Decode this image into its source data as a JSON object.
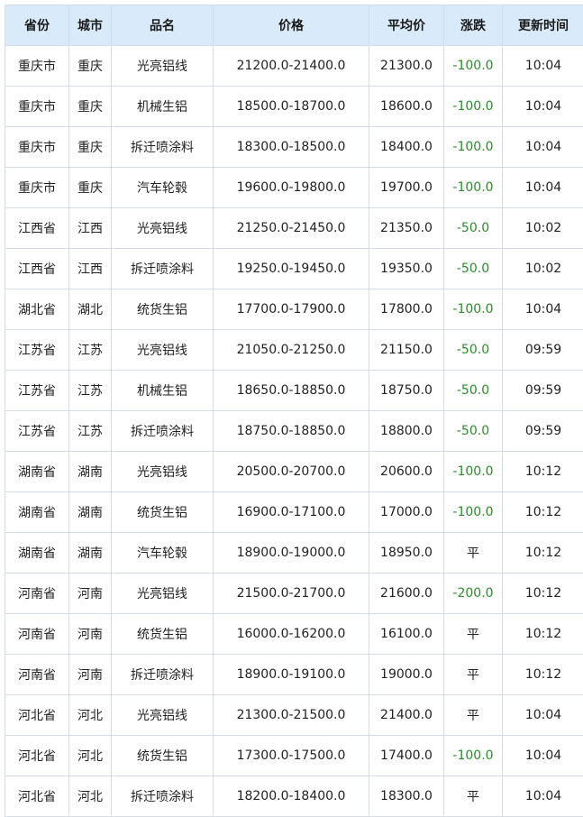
{
  "table": {
    "headers": [
      "省份",
      "城市",
      "品名",
      "价格",
      "平均价",
      "涨跌",
      "更新时间"
    ],
    "rows": [
      [
        "重庆市",
        "重庆",
        "光亮铝线",
        "21200.0-21400.0",
        "21300.0",
        "-100.0",
        "10:04"
      ],
      [
        "重庆市",
        "重庆",
        "机械生铝",
        "18500.0-18700.0",
        "18600.0",
        "-100.0",
        "10:04"
      ],
      [
        "重庆市",
        "重庆",
        "拆迁喷涂料",
        "18300.0-18500.0",
        "18400.0",
        "-100.0",
        "10:04"
      ],
      [
        "重庆市",
        "重庆",
        "汽车轮毂",
        "19600.0-19800.0",
        "19700.0",
        "-100.0",
        "10:04"
      ],
      [
        "江西省",
        "江西",
        "光亮铝线",
        "21250.0-21450.0",
        "21350.0",
        "-50.0",
        "10:02"
      ],
      [
        "江西省",
        "江西",
        "拆迁喷涂料",
        "19250.0-19450.0",
        "19350.0",
        "-50.0",
        "10:02"
      ],
      [
        "湖北省",
        "湖北",
        "统货生铝",
        "17700.0-17900.0",
        "17800.0",
        "-100.0",
        "10:04"
      ],
      [
        "江苏省",
        "江苏",
        "光亮铝线",
        "21050.0-21250.0",
        "21150.0",
        "-50.0",
        "09:59"
      ],
      [
        "江苏省",
        "江苏",
        "机械生铝",
        "18650.0-18850.0",
        "18750.0",
        "-50.0",
        "09:59"
      ],
      [
        "江苏省",
        "江苏",
        "拆迁喷涂料",
        "18750.0-18850.0",
        "18800.0",
        "-50.0",
        "09:59"
      ],
      [
        "湖南省",
        "湖南",
        "光亮铝线",
        "20500.0-20700.0",
        "20600.0",
        "-100.0",
        "10:12"
      ],
      [
        "湖南省",
        "湖南",
        "统货生铝",
        "16900.0-17100.0",
        "17000.0",
        "-100.0",
        "10:12"
      ],
      [
        "湖南省",
        "湖南",
        "汽车轮毂",
        "18900.0-19000.0",
        "18950.0",
        "平",
        "10:12"
      ],
      [
        "河南省",
        "河南",
        "光亮铝线",
        "21500.0-21700.0",
        "21600.0",
        "-200.0",
        "10:12"
      ],
      [
        "河南省",
        "河南",
        "统货生铝",
        "16000.0-16200.0",
        "16100.0",
        "平",
        "10:12"
      ],
      [
        "河南省",
        "河南",
        "拆迁喷涂料",
        "18900.0-19100.0",
        "19000.0",
        "平",
        "10:12"
      ],
      [
        "河北省",
        "河北",
        "光亮铝线",
        "21300.0-21500.0",
        "21400.0",
        "平",
        "10:04"
      ],
      [
        "河北省",
        "河北",
        "统货生铝",
        "17300.0-17500.0",
        "17400.0",
        "-100.0",
        "10:04"
      ],
      [
        "河北省",
        "河北",
        "拆迁喷涂料",
        "18200.0-18400.0",
        "18300.0",
        "平",
        "10:04"
      ]
    ]
  },
  "colors": {
    "header_bg": "#d9ebfb",
    "border": "#d6dde8",
    "down": "#2e8b2e",
    "flat": "#222222"
  }
}
